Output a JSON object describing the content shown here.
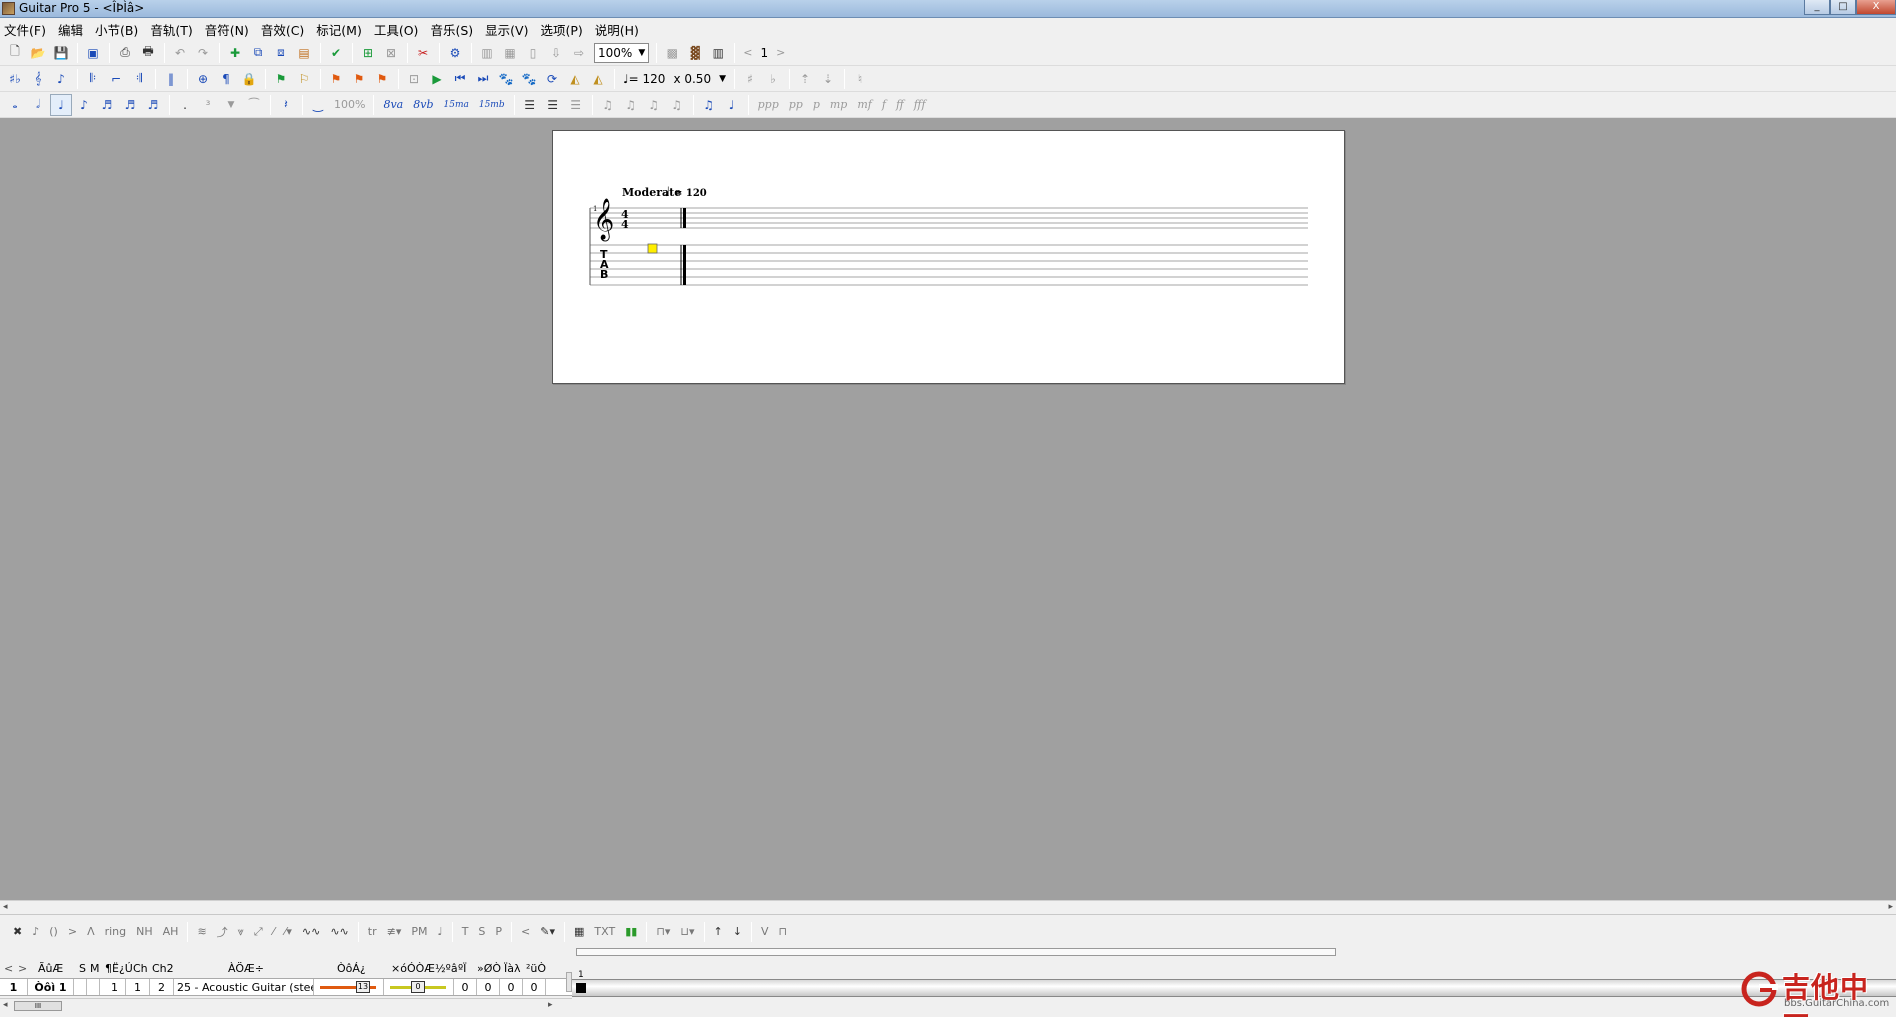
{
  "window": {
    "title": "Guitar Pro 5 - <ÎÞÌâ>",
    "min": "_",
    "max": "□",
    "close": "X"
  },
  "menu": [
    "文件(F)",
    "编辑",
    "小节(B)",
    "音轨(T)",
    "音符(N)",
    "音效(C)",
    "标记(M)",
    "工具(O)",
    "音乐(S)",
    "显示(V)",
    "选项(P)",
    "说明(H)"
  ],
  "toolbar1": {
    "zoom": "100%",
    "page": "1",
    "prev": "<",
    "next": ">"
  },
  "toolbar2": {
    "tempo": "♩= 120",
    "speed": "x 0.50"
  },
  "toolbar3": {
    "percent": "100%",
    "ottava_up": "8va",
    "ottava_down": "8vb",
    "quindicesima_up": "15ma",
    "quindicesima_down": "15mb",
    "dynamics": [
      "ppp",
      "pp",
      "p",
      "mp",
      "mf",
      "f",
      "ff",
      "fff"
    ]
  },
  "score": {
    "tempo_label": "Moderate",
    "tempo_value": "= 120",
    "measure_number": "1",
    "time_top": "4",
    "time_bottom": "4",
    "tab_t": "T",
    "tab_a": "A",
    "tab_b": "B"
  },
  "fx_toolbar": {
    "pm": "PM",
    "tr": "tr",
    "t": "T",
    "s": "S",
    "p": "P",
    "txt": "TXT",
    "nh": "NH",
    "ah": "AH",
    "v": "V"
  },
  "tracks": {
    "headers": {
      "name": "ÃûÆ",
      "s": "S",
      "m": "M",
      "port": "¶Ë¿Ú",
      "ch": "Ch",
      "ch2": "Ch2",
      "instrument": "ÀÖÆ÷",
      "volume": "ÒôÁ¿",
      "pan": "×óÓÒÆ½ºâ",
      "chorus": "ºÏ",
      "reverb": "»ØÒ",
      "phaser": "Ïàλ",
      "tremolo": "²üÒ"
    },
    "row": {
      "num": "1",
      "name": "Òôì 1",
      "port": "1",
      "ch": "1",
      "ch2": "2",
      "instrument": "25 - Acoustic Guitar (steel)",
      "volume": "13",
      "pan": "0",
      "chorus": "0",
      "reverb": "0",
      "phaser": "0",
      "tremolo": "0"
    },
    "nav_prev": "<",
    "nav_next": ">",
    "scroll_thumb": "III"
  },
  "measure_bar": {
    "number": "1"
  },
  "watermark": {
    "text": "吉他中国",
    "url": "bbs.GuitarChina.com"
  }
}
